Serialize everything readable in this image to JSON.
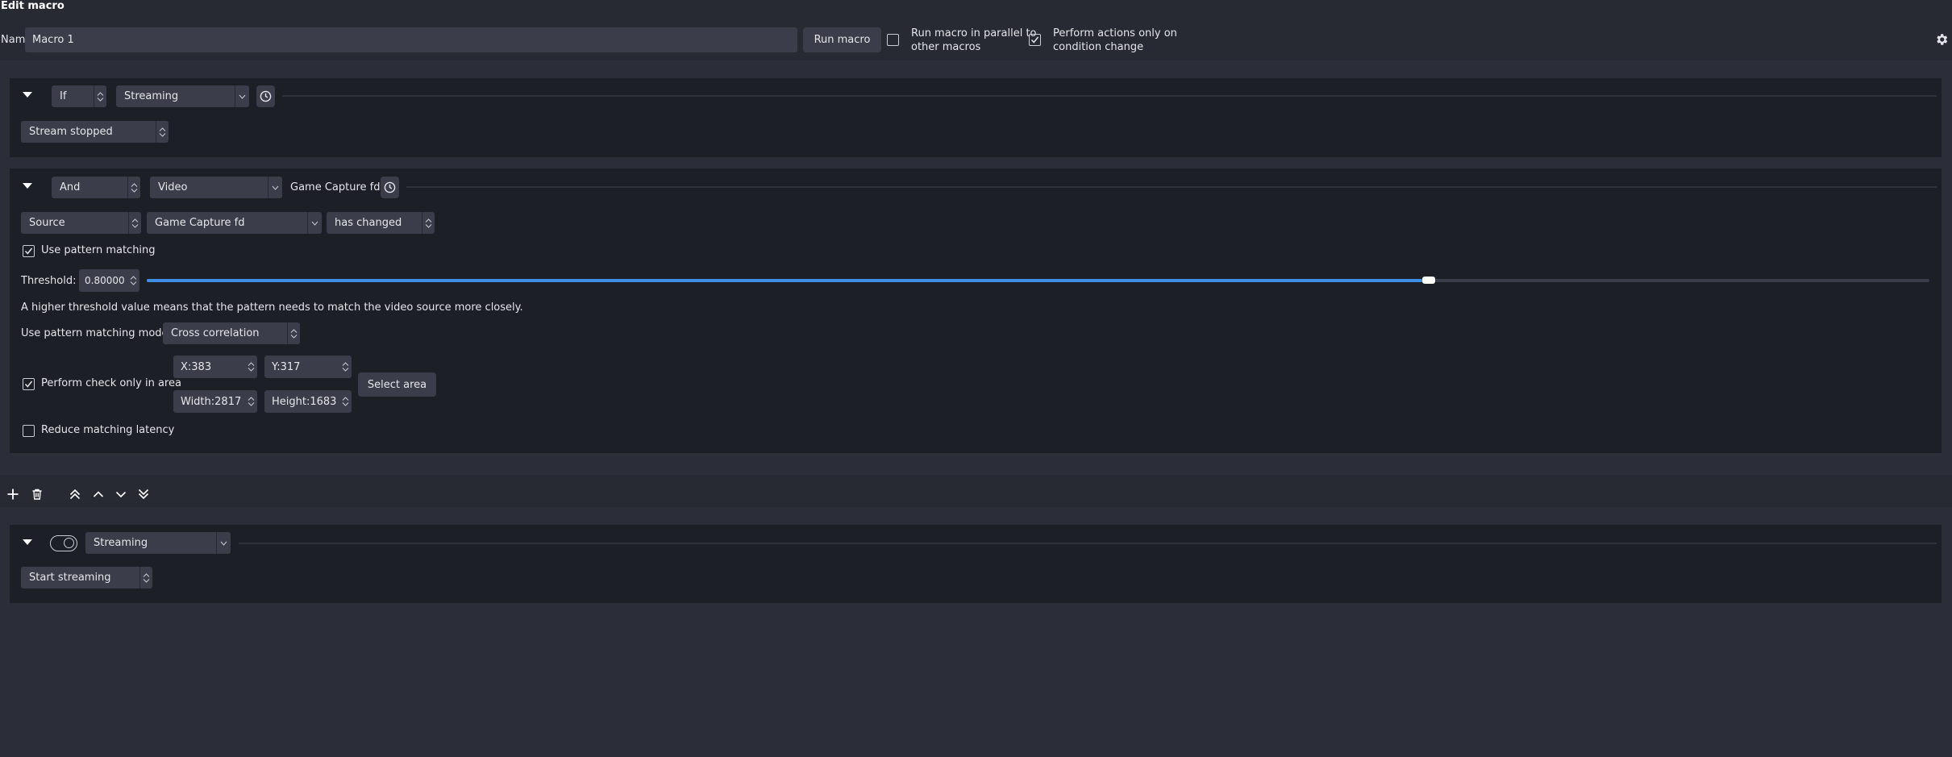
{
  "window": {
    "title": "Edit macro"
  },
  "header": {
    "name_label": "Name:",
    "name_value": "Macro 1",
    "run_button": "Run macro",
    "parallel_label_1": "Run macro in parallel to",
    "parallel_label_2": "other macros",
    "parallel_checked": false,
    "cond_label_1": "Perform actions only on",
    "cond_label_2": "condition change",
    "cond_checked": true
  },
  "condition1": {
    "logic": "If",
    "type": "Streaming",
    "state": "Stream stopped"
  },
  "condition2": {
    "logic": "And",
    "type": "Video",
    "summary": "Game Capture fd",
    "source_kind": "Source",
    "source_name": "Game Capture fd",
    "check": "has changed",
    "use_pattern_label": "Use pattern matching",
    "use_pattern_checked": true,
    "threshold_label": "Threshold:",
    "threshold_value": "0.80000",
    "threshold_fraction": 0.8,
    "threshold_hint": "A higher threshold value means that the pattern needs to match the video source more closely.",
    "mode_label": "Use pattern matching mode",
    "mode_value": "Cross correlation",
    "area_label": "Perform check only in area",
    "area_checked": true,
    "x": "X:383",
    "y": "Y:317",
    "width": "Width:2817",
    "height": "Height:1683",
    "select_area": "Select area",
    "latency_label": "Reduce matching latency",
    "latency_checked": false
  },
  "action1": {
    "type": "Streaming",
    "action": "Start streaming"
  },
  "icons": [
    "settings-icon",
    "add-icon",
    "trash-icon",
    "move-top-icon",
    "move-up-icon",
    "move-down-icon",
    "move-bottom-icon",
    "clock-icon",
    "toggle-icon"
  ]
}
